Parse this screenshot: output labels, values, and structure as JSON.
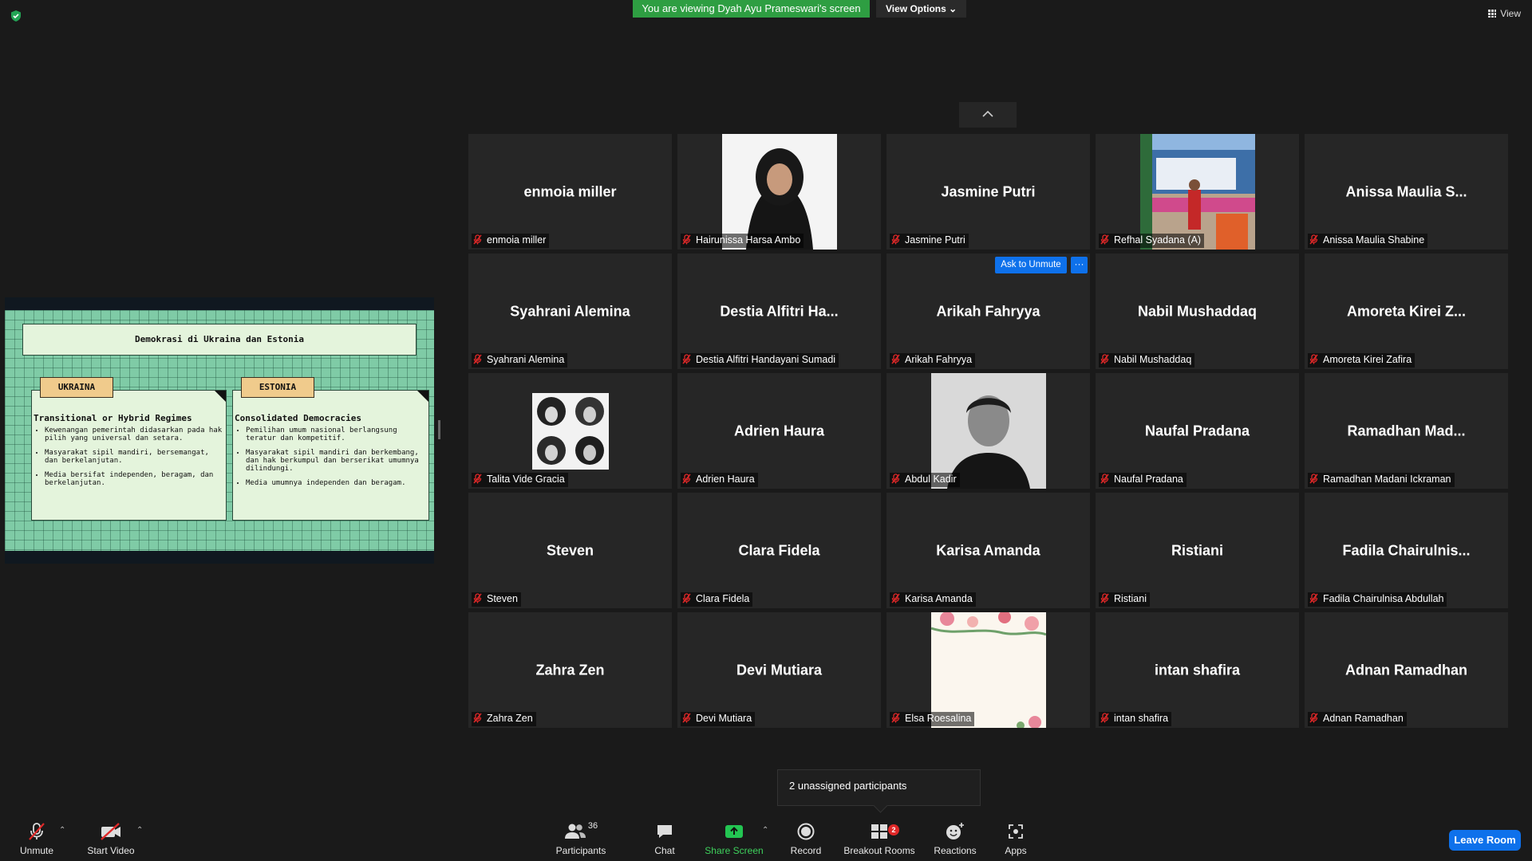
{
  "banner": {
    "viewing_text": "You are viewing Dyah Ayu Prameswari's screen",
    "view_options_label": "View Options"
  },
  "top_right": {
    "view_label": "View"
  },
  "shared_slide": {
    "title": "Demokrasi di Ukraina dan Estonia",
    "cards": [
      {
        "tag": "UKRAINA",
        "heading": "Transitional or Hybrid Regimes",
        "bullets": [
          "Kewenangan pemerintah didasarkan pada hak pilih yang universal dan setara.",
          "Masyarakat sipil mandiri, bersemangat, dan berkelanjutan.",
          "Media bersifat independen, beragam, dan berkelanjutan."
        ]
      },
      {
        "tag": "ESTONIA",
        "heading": "Consolidated Democracies",
        "bullets": [
          "Pemilihan umum nasional berlangsung teratur dan kompetitif.",
          "Masyarakat sipil mandiri dan berkembang, dan hak berkumpul dan berserikat umumnya dilindungi.",
          "Media umumnya independen dan beragam."
        ]
      }
    ]
  },
  "participants_grid": [
    {
      "display": "enmoia miller",
      "name": "enmoia miller",
      "video": false
    },
    {
      "display": "",
      "name": "Hairunissa Harsa Ambo",
      "video": true,
      "video_kind": "portrait-hijab"
    },
    {
      "display": "Jasmine Putri",
      "name": "Jasmine Putri",
      "video": false
    },
    {
      "display": "",
      "name": "Refhal Syadana (A)",
      "video": true,
      "video_kind": "outdoor-photo"
    },
    {
      "display": "Anissa Maulia S...",
      "name": "Anissa Maulia Shabine",
      "video": false
    },
    {
      "display": "Syahrani Alemina",
      "name": "Syahrani Alemina",
      "video": false
    },
    {
      "display": "Destia Alfitri Ha...",
      "name": "Destia Alfitri Handayani Sumadi",
      "video": false
    },
    {
      "display": "Arikah Fahryya",
      "name": "Arikah Fahryya",
      "video": false
    },
    {
      "display": "Nabil Mushaddaq",
      "name": "Nabil Mushaddaq",
      "video": false
    },
    {
      "display": "Amoreta Kirei Z...",
      "name": "Amoreta Kirei Zafira",
      "video": false
    },
    {
      "display": "",
      "name": "Talita Vide Gracia",
      "video": true,
      "video_kind": "photo-collage"
    },
    {
      "display": "Adrien Haura",
      "name": "Adrien Haura",
      "video": false
    },
    {
      "display": "",
      "name": "Abdul Kadir",
      "video": true,
      "video_kind": "webcam-bw"
    },
    {
      "display": "Naufal Pradana",
      "name": "Naufal Pradana",
      "video": false
    },
    {
      "display": "Ramadhan Mad...",
      "name": "Ramadhan Madani Ickraman",
      "video": false
    },
    {
      "display": "Steven",
      "name": "Steven",
      "video": false
    },
    {
      "display": "Clara Fidela",
      "name": "Clara Fidela",
      "video": false
    },
    {
      "display": "Karisa Amanda",
      "name": "Karisa Amanda",
      "video": false
    },
    {
      "display": "Ristiani",
      "name": "Ristiani",
      "video": false
    },
    {
      "display": "Fadila  Chairulnis...",
      "name": "Fadila Chairulnisa Abdullah",
      "video": false
    },
    {
      "display": "Zahra Zen",
      "name": "Zahra Zen",
      "video": false
    },
    {
      "display": "Devi Mutiara",
      "name": "Devi Mutiara",
      "video": false
    },
    {
      "display": "",
      "name": "Elsa Roesalina",
      "video": true,
      "video_kind": "floral-background"
    },
    {
      "display": "intan shafira",
      "name": "intan shafira",
      "video": false
    },
    {
      "display": "Adnan Ramadhan",
      "name": "Adnan Ramadhan",
      "video": false
    }
  ],
  "ask_unmute": {
    "label": "Ask to Unmute",
    "more": "···"
  },
  "popover": {
    "unassigned_text": "2 unassigned participants"
  },
  "toolbar": {
    "unmute": "Unmute",
    "start_video": "Start Video",
    "participants": "Participants",
    "participants_count": "36",
    "chat": "Chat",
    "share_screen": "Share Screen",
    "record": "Record",
    "breakout_rooms": "Breakout Rooms",
    "breakout_badge": "2",
    "reactions": "Reactions",
    "apps": "Apps",
    "leave_room": "Leave Room"
  },
  "colors": {
    "accent": "#0e71eb",
    "banner_green": "#2e9e42",
    "muted_red": "#e02828",
    "tile_bg": "#262626"
  }
}
